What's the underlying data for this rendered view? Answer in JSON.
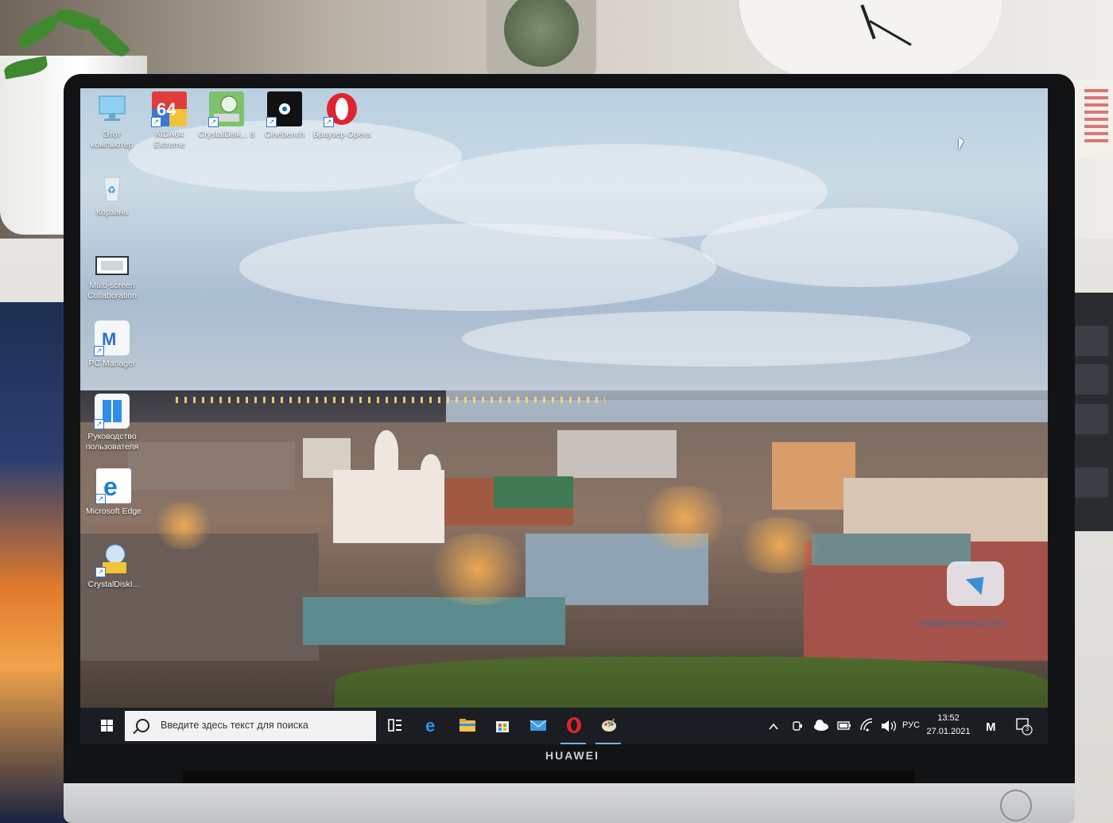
{
  "desktop": {
    "icons": [
      {
        "label": "Этот компьютер",
        "icon": "this-pc-icon"
      },
      {
        "label": "AIDA64 Extreme",
        "icon": "aida64-icon",
        "badge": "64"
      },
      {
        "label": "CrystalDisk... 8",
        "icon": "crystaldiskmark-icon"
      },
      {
        "label": "Cinebench",
        "icon": "cinebench-icon"
      },
      {
        "label": "Браузер Opera",
        "icon": "opera-icon"
      },
      {
        "label": "Корзина",
        "icon": "recycle-bin-icon"
      },
      {
        "label": "Multi-screen Collaboration",
        "icon": "multiscreen-icon"
      },
      {
        "label": "PC Manager",
        "icon": "pc-manager-icon"
      },
      {
        "label": "Руководство пользователя",
        "icon": "user-guide-icon"
      },
      {
        "label": "Microsoft Edge",
        "icon": "edge-icon"
      },
      {
        "label": "CrystalDiskI...",
        "icon": "crystaldiskinfo-icon"
      }
    ]
  },
  "taskbar": {
    "search_placeholder": "Введите здесь текст для поиска",
    "pinned": [
      {
        "name": "task-view",
        "icon": "task-view-icon"
      },
      {
        "name": "edge",
        "icon": "edge-icon"
      },
      {
        "name": "file-explorer",
        "icon": "folder-icon"
      },
      {
        "name": "store",
        "icon": "store-icon"
      },
      {
        "name": "mail",
        "icon": "mail-icon"
      },
      {
        "name": "opera",
        "icon": "opera-icon",
        "active": true
      },
      {
        "name": "paint",
        "icon": "paint-icon",
        "active": true
      }
    ],
    "tray": {
      "language": "РУС",
      "time": "13:52",
      "date": "27.01.2021",
      "notification_count": "3"
    }
  },
  "laptop": {
    "brand": "HUAWEI"
  },
  "watermark": "mobile-review.com",
  "colors": {
    "taskbar_bg": "#1a1d22",
    "accent": "#6fb4f0",
    "opera_red": "#e0242e",
    "edge_blue": "#1e7fd6"
  }
}
